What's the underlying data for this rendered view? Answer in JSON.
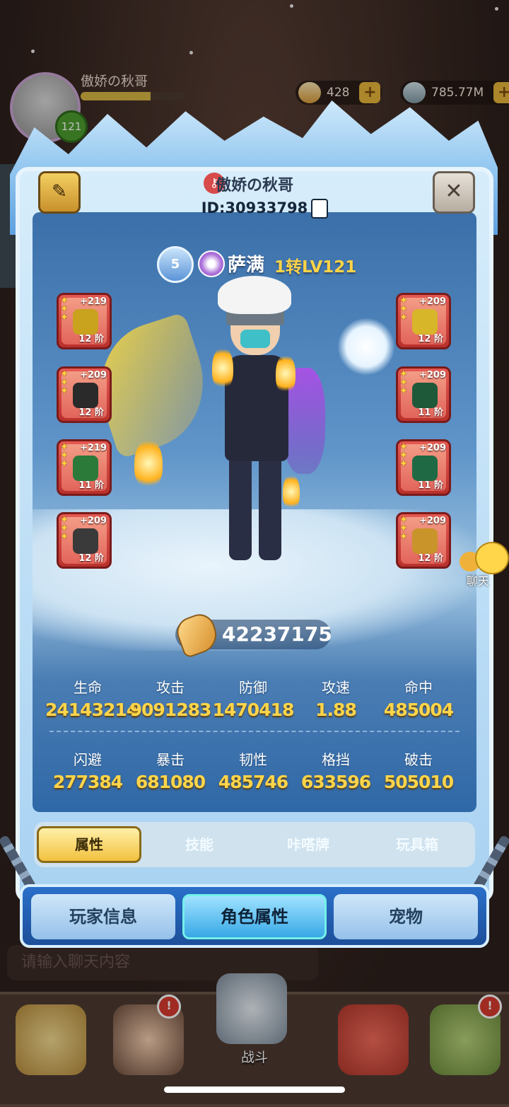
{
  "background": {
    "player_name": "傲娇の秋哥",
    "player_level": "121",
    "exp_progress": 0.66,
    "resources": [
      {
        "icon": "gem-icon",
        "value": "428"
      },
      {
        "icon": "ore-icon",
        "value": "785.77M"
      }
    ],
    "chat_placeholder": "请输入聊天内容",
    "nav": {
      "center_label": "战斗",
      "badge": "!"
    }
  },
  "header": {
    "name": "傲娇の秋哥",
    "id": "ID:30933798"
  },
  "character": {
    "rank": "5",
    "class_name": "萨满",
    "level": "1转LV121"
  },
  "equipment": {
    "left": [
      {
        "plus": "+219",
        "tier": "12 阶",
        "color": "#c9a21e"
      },
      {
        "plus": "+209",
        "tier": "12 阶",
        "color": "#2a2a2a"
      },
      {
        "plus": "+219",
        "tier": "11 阶",
        "color": "#2b7a3a"
      },
      {
        "plus": "+209",
        "tier": "12 阶",
        "color": "#3a3a3a"
      }
    ],
    "right": [
      {
        "plus": "+209",
        "tier": "12 阶",
        "color": "#d7b62a"
      },
      {
        "plus": "+209",
        "tier": "11 阶",
        "color": "#1e5a3a"
      },
      {
        "plus": "+209",
        "tier": "11 阶",
        "color": "#1f6a44"
      },
      {
        "plus": "+209",
        "tier": "12 阶",
        "color": "#c9942a"
      }
    ]
  },
  "power": "42237175",
  "stats": [
    {
      "label": "生命",
      "value": "24143214"
    },
    {
      "label": "攻击",
      "value": "9091283"
    },
    {
      "label": "防御",
      "value": "1470418"
    },
    {
      "label": "攻速",
      "value": "1.88"
    },
    {
      "label": "命中",
      "value": "485004"
    },
    {
      "label": "闪避",
      "value": "277384"
    },
    {
      "label": "暴击",
      "value": "681080"
    },
    {
      "label": "韧性",
      "value": "485746"
    },
    {
      "label": "格挡",
      "value": "633596"
    },
    {
      "label": "破击",
      "value": "505010"
    }
  ],
  "chat": {
    "label": "聊天"
  },
  "subtabs": [
    "属性",
    "技能",
    "咔嗒牌",
    "玩具箱"
  ],
  "maintabs": [
    "玩家信息",
    "角色属性",
    "宠物"
  ],
  "colors": {
    "accent": "#ffd54a",
    "active_subtab": "#f2c23e",
    "active_maintab": "#38a8e6"
  }
}
